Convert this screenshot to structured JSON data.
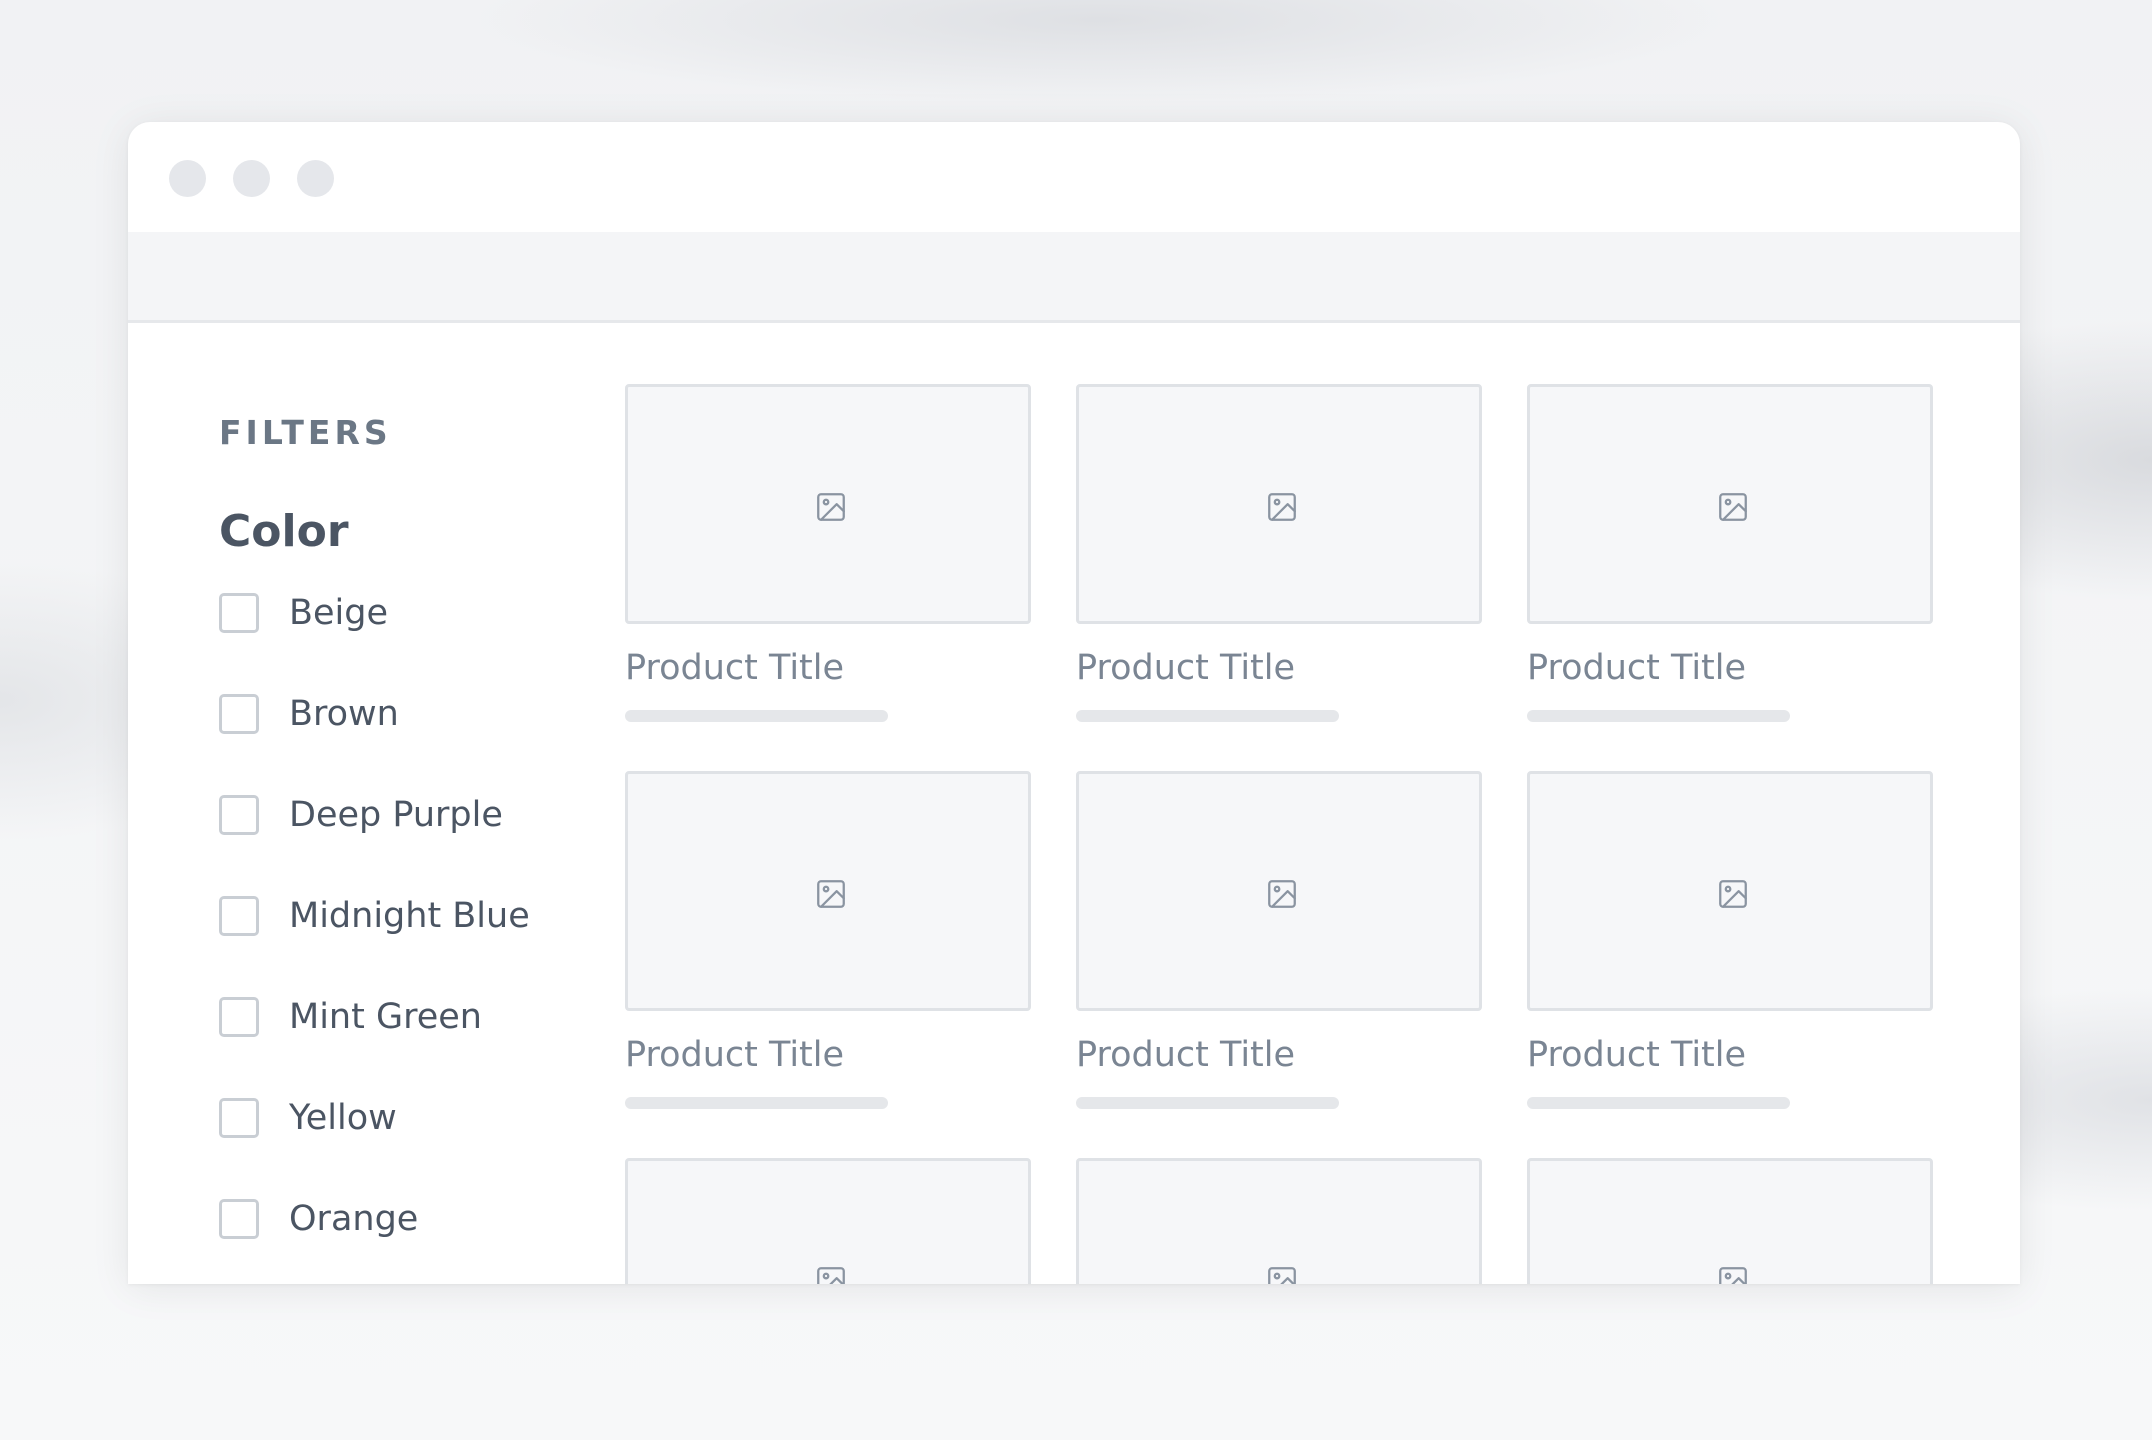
{
  "window": {
    "controls": [
      "close",
      "minimize",
      "maximize"
    ]
  },
  "sidebar": {
    "filters_heading": "FILTERS",
    "color_heading": "Color",
    "options": [
      {
        "label": "Beige",
        "checked": false
      },
      {
        "label": "Brown",
        "checked": false
      },
      {
        "label": "Deep Purple",
        "checked": false
      },
      {
        "label": "Midnight Blue",
        "checked": false
      },
      {
        "label": "Mint Green",
        "checked": false
      },
      {
        "label": "Yellow",
        "checked": false
      },
      {
        "label": "Orange",
        "checked": false
      }
    ]
  },
  "products": [
    {
      "title": "Product Title",
      "image_icon": "image-icon"
    },
    {
      "title": "Product Title",
      "image_icon": "image-icon"
    },
    {
      "title": "Product Title",
      "image_icon": "image-icon"
    },
    {
      "title": "Product Title",
      "image_icon": "image-icon"
    },
    {
      "title": "Product Title",
      "image_icon": "image-icon"
    },
    {
      "title": "Product Title",
      "image_icon": "image-icon"
    },
    {
      "title": "",
      "image_icon": "image-icon"
    },
    {
      "title": "",
      "image_icon": "image-icon"
    },
    {
      "title": "",
      "image_icon": "image-icon"
    }
  ],
  "colors": {
    "window_bg": "#ffffff",
    "toolbar_bg": "#f4f5f7",
    "text_primary": "#4b5563",
    "text_muted": "#7a8593",
    "border": "#dfe2e6"
  }
}
